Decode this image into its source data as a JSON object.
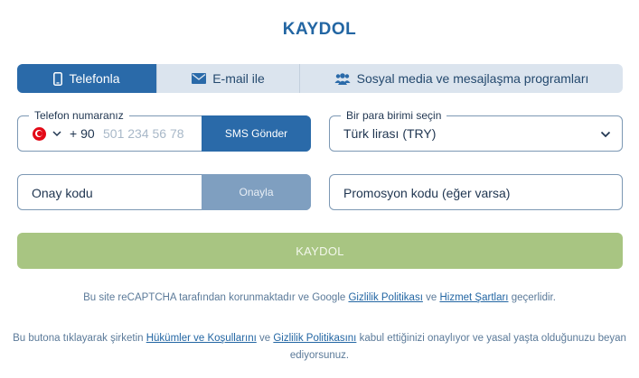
{
  "title": "KAYDOL",
  "tabs": [
    {
      "label": "Telefonla",
      "icon": "phone-icon",
      "active": true
    },
    {
      "label": "E-mail ile",
      "icon": "envelope-icon",
      "active": false
    },
    {
      "label": "Sosyal media ve mesajlaşma programları",
      "icon": "users-icon",
      "active": false
    }
  ],
  "phone": {
    "label": "Telefon numaranız",
    "country_code": "+ 90",
    "placeholder": "501 234 56 78",
    "value": "",
    "send_button": "SMS Gönder"
  },
  "currency": {
    "label": "Bir para birimi seçin",
    "selected": "Türk lirası (TRY)"
  },
  "confirm": {
    "placeholder": "Onay kodu",
    "button": "Onayla"
  },
  "promo": {
    "placeholder": "Promosyon kodu (eğer varsa)"
  },
  "submit_label": "KAYDOL",
  "recaptcha": {
    "pre": "Bu site reCAPTCHA tarafından korunmaktadır ve Google ",
    "privacy": "Gizlilik Politikası",
    "mid": " ve ",
    "terms": "Hizmet Şartları",
    "post": " geçerlidir."
  },
  "consent": {
    "pre": "Bu butona tıklayarak şirketin ",
    "terms": "Hükümler ve Koşullarını",
    "mid": " ve ",
    "privacy": "Gizlilik Politikasını",
    "post": " kabul ettiğinizi onaylıyor ve yasal yaşta olduğunuzu beyan ediyorsunuz."
  },
  "colors": {
    "accent": "#2a6aa9",
    "submit_disabled": "#a8c582",
    "approve_disabled": "#7f9fc0"
  }
}
